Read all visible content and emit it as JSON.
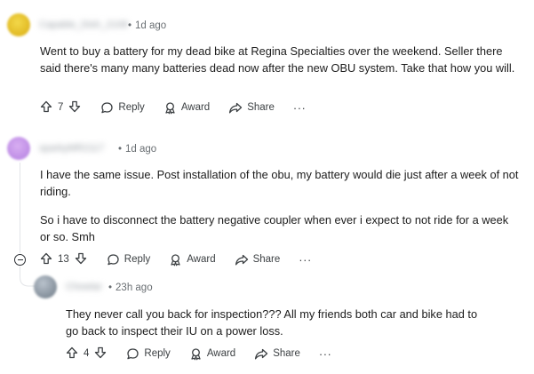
{
  "comments": [
    {
      "username": "Capable_Dish_2108",
      "age": "1d ago",
      "paragraphs": [
        "Went to buy a battery for my dead bike at Regina Specialties over the weekend. Seller there said there's many many batteries dead now after the new OBU system. Take that how you will."
      ],
      "votes": "7",
      "reply_label": "Reply",
      "award_label": "Award",
      "share_label": "Share",
      "more_label": "···",
      "avatar_color": "#e8c31c"
    },
    {
      "username": "sparkyMR2117",
      "age": "1d ago",
      "paragraphs": [
        "I have the same issue. Post installation of the obu, my battery would die just after a week of not riding.",
        "So i have to disconnect the battery negative coupler when ever i expect to not ride for a week or so. Smh"
      ],
      "votes": "13",
      "reply_label": "Reply",
      "award_label": "Award",
      "share_label": "Share",
      "more_label": "···",
      "avatar_color": "#c58ee8"
    },
    {
      "username": "Chowtar",
      "age": "23h ago",
      "paragraphs": [
        "They never call you back for inspection??? All my friends both car and bike had to go back to inspect their IU on a power loss."
      ],
      "votes": "4",
      "reply_label": "Reply",
      "award_label": "Award",
      "share_label": "Share",
      "more_label": "···",
      "avatar_color": "#8a96a3"
    }
  ]
}
